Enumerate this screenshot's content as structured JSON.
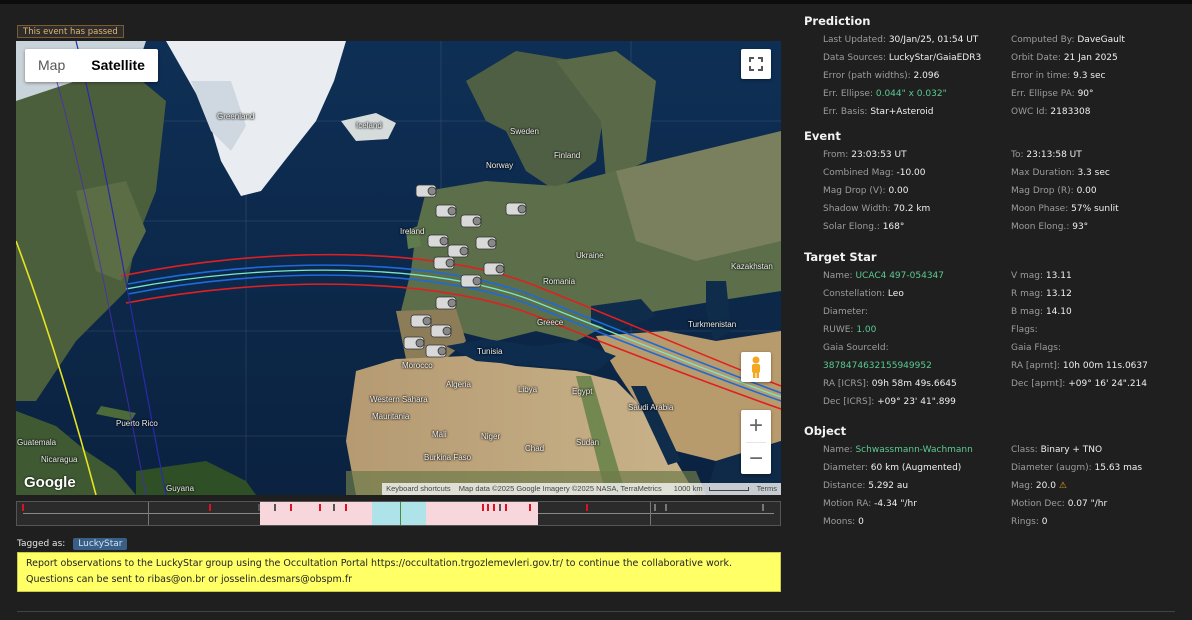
{
  "badge": "This event has passed",
  "map": {
    "type_buttons": [
      "Map",
      "Satellite"
    ],
    "active_type": "Satellite",
    "google": "Google",
    "attribution": [
      "Keyboard shortcuts",
      "Map data ©2025 Google Imagery ©2025 NASA, TerraMetrics",
      "1000 km",
      "Terms"
    ],
    "labels": [
      "Greenland",
      "Iceland",
      "Sweden",
      "Finland",
      "Norway",
      "Ireland",
      "Ukraine",
      "Kazakhstan",
      "Romania",
      "Turkmenistan",
      "Greece",
      "Tunisia",
      "Morocco",
      "Algeria",
      "Libya",
      "Egypt",
      "Saudi Arabia",
      "Mali",
      "Niger",
      "Chad",
      "Sudan",
      "Burkina Faso",
      "Puerto Rico",
      "Guatemala",
      "Nicaragua",
      "Guyana",
      "Mauritania",
      "Western Sahara"
    ]
  },
  "tagged": {
    "label": "Tagged as:",
    "tag": "LuckyStar"
  },
  "notice": "Report observations to the LuckyStar group using the Occultation Portal https://occultation.trgozlemevleri.gov.tr/ to continue the collaborative work. Questions can be sent to ribas@on.br or josselin.desmars@obspm.fr",
  "prediction": {
    "title": "Prediction",
    "rows": [
      [
        "Last Updated:",
        "30/Jan/25, 01:54 UT",
        "Computed By:",
        "DaveGault"
      ],
      [
        "Data Sources:",
        "LuckyStar/GaiaEDR3",
        "Orbit Date:",
        "21 Jan 2025"
      ],
      [
        "Error (path widths):",
        "2.096",
        "Error in time:",
        "9.3 sec"
      ],
      [
        "Err. Ellipse:",
        "0.044\" x 0.032\"",
        "Err. Ellipse PA:",
        "90°"
      ],
      [
        "Err. Basis:",
        "Star+Asteroid",
        "OWC Id:",
        "2183308"
      ]
    ]
  },
  "event": {
    "title": "Event",
    "rows": [
      [
        "From:",
        "23:03:53 UT",
        "To:",
        "23:13:58 UT"
      ],
      [
        "Combined Mag:",
        "-10.00",
        "Max Duration:",
        "3.3 sec"
      ],
      [
        "Mag Drop (V):",
        "0.00",
        "Mag Drop (R):",
        "0.00"
      ],
      [
        "Shadow Width:",
        "70.2 km",
        "Moon Phase:",
        "57% sunlit"
      ],
      [
        "Solar Elong.:",
        "168°",
        "Moon Elong.:",
        "93°"
      ]
    ]
  },
  "target_star": {
    "title": "Target Star",
    "name_label": "Name:",
    "name": "UCAC4 497-054347",
    "vmag_label": "V mag:",
    "vmag": "13.11",
    "constellation_label": "Constellation:",
    "constellation": "Leo",
    "rmag_label": "R mag:",
    "rmag": "13.12",
    "diameter_label": "Diameter:",
    "diameter": "",
    "bmag_label": "B mag:",
    "bmag": "14.10",
    "ruwe_label": "RUWE:",
    "ruwe": "1.00",
    "flags_label": "Flags:",
    "flags": "",
    "gaia_source_label": "Gaia SourceId:",
    "gaia_flags_label": "Gaia Flags:",
    "gaia_source": "3878474632155949952",
    "ra_apparent_label": "RA [aprnt]:",
    "ra_apparent": "10h 00m 11s.0637",
    "ra_icrs_label": "RA [ICRS]:",
    "ra_icrs": "09h 58m 49s.6645",
    "dec_apparent_label": "Dec [aprnt]:",
    "dec_apparent": "+09° 16' 24\".214",
    "dec_icrs_label": "Dec [ICRS]:",
    "dec_icrs": "+09° 23' 41\".899"
  },
  "object": {
    "title": "Object",
    "name_label": "Name:",
    "name": "Schwassmann-Wachmann",
    "class_label": "Class:",
    "class": "Binary + TNO",
    "diameter_label": "Diameter:",
    "diameter": "60 km (Augmented)",
    "diameter_augm_label": "Diameter (augm):",
    "diameter_augm": "15.63 mas",
    "distance_label": "Distance:",
    "distance": "5.292 au",
    "mag_label": "Mag:",
    "mag": "20.0",
    "motion_ra_label": "Motion RA:",
    "motion_ra": "-4.34 \"/hr",
    "motion_dec_label": "Motion Dec:",
    "motion_dec": "0.07 \"/hr",
    "moons_label": "Moons:",
    "moons": "0",
    "rings_label": "Rings:",
    "rings": "0"
  },
  "colors": {
    "accent_green": "#5cc991",
    "notice_bg": "#ffff66",
    "path_red": "#e02020",
    "path_center": "#48c8ff"
  }
}
